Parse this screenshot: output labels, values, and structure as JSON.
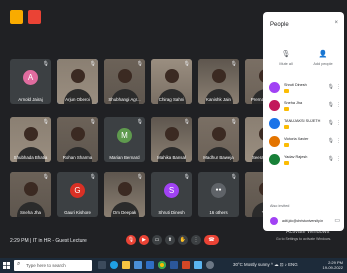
{
  "meeting": {
    "time": "2:29 PM",
    "separator": "|",
    "title": "IT in HR - Guest Lecture",
    "tiles": [
      {
        "name": "Arnold Jairaj",
        "initial": "A",
        "color": "#e06c9f",
        "video": false
      },
      {
        "name": "Arjun Oberoi",
        "initial": "",
        "color": "",
        "video": true,
        "speaking": true
      },
      {
        "name": "Shubhangi Agr...",
        "initial": "",
        "color": "",
        "video": true
      },
      {
        "name": "Chirag Sahni",
        "initial": "",
        "color": "",
        "video": true
      },
      {
        "name": "Kanishk Jain",
        "initial": "",
        "color": "",
        "video": true
      },
      {
        "name": "Prerna Saxena",
        "initial": "",
        "color": "",
        "video": true
      },
      {
        "name": "Shubhada Bhatia",
        "initial": "",
        "color": "",
        "video": true
      },
      {
        "name": "Rohan Sharma",
        "initial": "",
        "color": "",
        "video": true
      },
      {
        "name": "Marian Bernard",
        "initial": "M",
        "color": "#5f9a4e",
        "video": false
      },
      {
        "name": "Mahika Bansal",
        "initial": "",
        "color": "",
        "video": true
      },
      {
        "name": "Madhur Baweja",
        "initial": "",
        "color": "",
        "video": true
      },
      {
        "name": "Seera Rathod",
        "initial": "",
        "color": "",
        "video": true
      },
      {
        "name": "Sneha Jha",
        "initial": "",
        "color": "",
        "video": true
      },
      {
        "name": "Gauri Kishore",
        "initial": "G",
        "color": "#d93025",
        "video": false
      },
      {
        "name": "Om Deepak",
        "initial": "",
        "color": "",
        "video": true
      },
      {
        "name": "Shruti Dinesh",
        "initial": "S",
        "color": "#a142f4",
        "video": false
      },
      {
        "name": "16 others",
        "initial": "",
        "color": "",
        "video": false,
        "others": true
      },
      {
        "name": "You",
        "initial": "",
        "color": "",
        "video": true
      }
    ],
    "controls": [
      "mic-off",
      "cam-off",
      "captions",
      "present",
      "raise-hand",
      "more",
      "end-call"
    ]
  },
  "people_panel": {
    "title": "People",
    "close": "×",
    "mute_all_label": "Mute all",
    "add_people_label": "Add people",
    "participants": [
      {
        "name": "Shruti Dinesh",
        "color": "#a142f4"
      },
      {
        "name": "Sneha Jha",
        "color": "#c2185b"
      },
      {
        "name": "TANUJAKSI SUJETH",
        "color": "#1a73e8"
      },
      {
        "name": "Victoria Xavier",
        "color": "#e37400"
      },
      {
        "name": "Yadav Rajesh",
        "color": "#188038"
      }
    ],
    "also_invited_label": "Also invited",
    "invited_email": "adit.jdc@christuniversity.in"
  },
  "watermark": {
    "line1": "Activate Windows",
    "line2": "Go to Settings to activate Windows."
  },
  "taskbar": {
    "search_placeholder": "Type here to search",
    "weather": "30°C  Mostly sunny",
    "tray_icons": "^ ☁ ⊡ ♪ ENG",
    "clock_time": "2:29 PM",
    "clock_date": "19-09-2022"
  }
}
